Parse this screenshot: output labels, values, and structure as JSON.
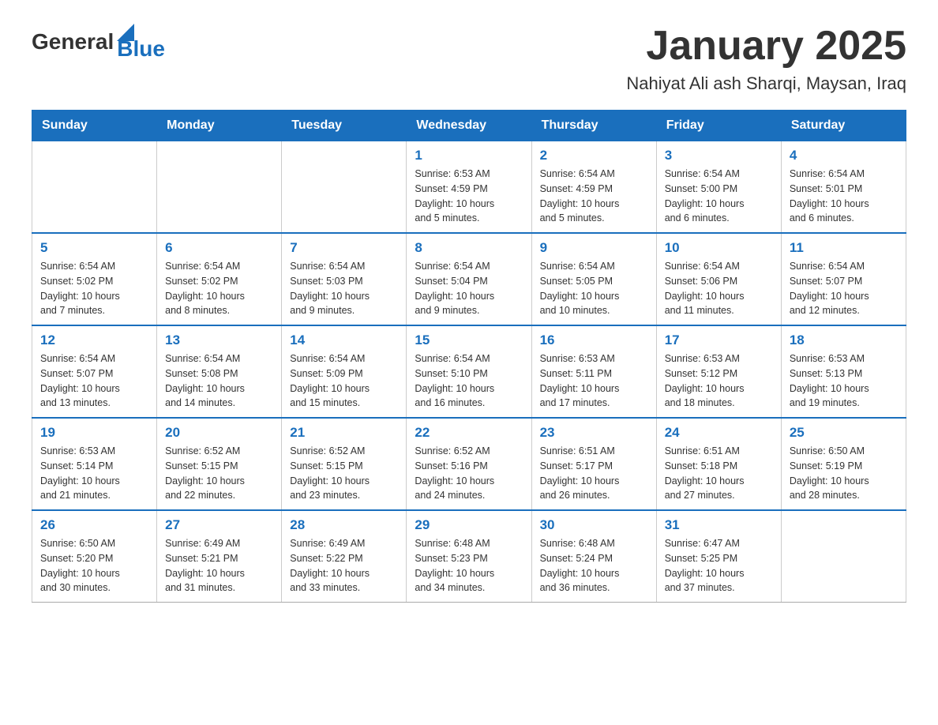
{
  "header": {
    "logo_general": "General",
    "logo_blue": "Blue",
    "month": "January 2025",
    "location": "Nahiyat Ali ash Sharqi, Maysan, Iraq"
  },
  "days_of_week": [
    "Sunday",
    "Monday",
    "Tuesday",
    "Wednesday",
    "Thursday",
    "Friday",
    "Saturday"
  ],
  "weeks": [
    [
      {
        "day": "",
        "info": ""
      },
      {
        "day": "",
        "info": ""
      },
      {
        "day": "",
        "info": ""
      },
      {
        "day": "1",
        "info": "Sunrise: 6:53 AM\nSunset: 4:59 PM\nDaylight: 10 hours\nand 5 minutes."
      },
      {
        "day": "2",
        "info": "Sunrise: 6:54 AM\nSunset: 4:59 PM\nDaylight: 10 hours\nand 5 minutes."
      },
      {
        "day": "3",
        "info": "Sunrise: 6:54 AM\nSunset: 5:00 PM\nDaylight: 10 hours\nand 6 minutes."
      },
      {
        "day": "4",
        "info": "Sunrise: 6:54 AM\nSunset: 5:01 PM\nDaylight: 10 hours\nand 6 minutes."
      }
    ],
    [
      {
        "day": "5",
        "info": "Sunrise: 6:54 AM\nSunset: 5:02 PM\nDaylight: 10 hours\nand 7 minutes."
      },
      {
        "day": "6",
        "info": "Sunrise: 6:54 AM\nSunset: 5:02 PM\nDaylight: 10 hours\nand 8 minutes."
      },
      {
        "day": "7",
        "info": "Sunrise: 6:54 AM\nSunset: 5:03 PM\nDaylight: 10 hours\nand 9 minutes."
      },
      {
        "day": "8",
        "info": "Sunrise: 6:54 AM\nSunset: 5:04 PM\nDaylight: 10 hours\nand 9 minutes."
      },
      {
        "day": "9",
        "info": "Sunrise: 6:54 AM\nSunset: 5:05 PM\nDaylight: 10 hours\nand 10 minutes."
      },
      {
        "day": "10",
        "info": "Sunrise: 6:54 AM\nSunset: 5:06 PM\nDaylight: 10 hours\nand 11 minutes."
      },
      {
        "day": "11",
        "info": "Sunrise: 6:54 AM\nSunset: 5:07 PM\nDaylight: 10 hours\nand 12 minutes."
      }
    ],
    [
      {
        "day": "12",
        "info": "Sunrise: 6:54 AM\nSunset: 5:07 PM\nDaylight: 10 hours\nand 13 minutes."
      },
      {
        "day": "13",
        "info": "Sunrise: 6:54 AM\nSunset: 5:08 PM\nDaylight: 10 hours\nand 14 minutes."
      },
      {
        "day": "14",
        "info": "Sunrise: 6:54 AM\nSunset: 5:09 PM\nDaylight: 10 hours\nand 15 minutes."
      },
      {
        "day": "15",
        "info": "Sunrise: 6:54 AM\nSunset: 5:10 PM\nDaylight: 10 hours\nand 16 minutes."
      },
      {
        "day": "16",
        "info": "Sunrise: 6:53 AM\nSunset: 5:11 PM\nDaylight: 10 hours\nand 17 minutes."
      },
      {
        "day": "17",
        "info": "Sunrise: 6:53 AM\nSunset: 5:12 PM\nDaylight: 10 hours\nand 18 minutes."
      },
      {
        "day": "18",
        "info": "Sunrise: 6:53 AM\nSunset: 5:13 PM\nDaylight: 10 hours\nand 19 minutes."
      }
    ],
    [
      {
        "day": "19",
        "info": "Sunrise: 6:53 AM\nSunset: 5:14 PM\nDaylight: 10 hours\nand 21 minutes."
      },
      {
        "day": "20",
        "info": "Sunrise: 6:52 AM\nSunset: 5:15 PM\nDaylight: 10 hours\nand 22 minutes."
      },
      {
        "day": "21",
        "info": "Sunrise: 6:52 AM\nSunset: 5:15 PM\nDaylight: 10 hours\nand 23 minutes."
      },
      {
        "day": "22",
        "info": "Sunrise: 6:52 AM\nSunset: 5:16 PM\nDaylight: 10 hours\nand 24 minutes."
      },
      {
        "day": "23",
        "info": "Sunrise: 6:51 AM\nSunset: 5:17 PM\nDaylight: 10 hours\nand 26 minutes."
      },
      {
        "day": "24",
        "info": "Sunrise: 6:51 AM\nSunset: 5:18 PM\nDaylight: 10 hours\nand 27 minutes."
      },
      {
        "day": "25",
        "info": "Sunrise: 6:50 AM\nSunset: 5:19 PM\nDaylight: 10 hours\nand 28 minutes."
      }
    ],
    [
      {
        "day": "26",
        "info": "Sunrise: 6:50 AM\nSunset: 5:20 PM\nDaylight: 10 hours\nand 30 minutes."
      },
      {
        "day": "27",
        "info": "Sunrise: 6:49 AM\nSunset: 5:21 PM\nDaylight: 10 hours\nand 31 minutes."
      },
      {
        "day": "28",
        "info": "Sunrise: 6:49 AM\nSunset: 5:22 PM\nDaylight: 10 hours\nand 33 minutes."
      },
      {
        "day": "29",
        "info": "Sunrise: 6:48 AM\nSunset: 5:23 PM\nDaylight: 10 hours\nand 34 minutes."
      },
      {
        "day": "30",
        "info": "Sunrise: 6:48 AM\nSunset: 5:24 PM\nDaylight: 10 hours\nand 36 minutes."
      },
      {
        "day": "31",
        "info": "Sunrise: 6:47 AM\nSunset: 5:25 PM\nDaylight: 10 hours\nand 37 minutes."
      },
      {
        "day": "",
        "info": ""
      }
    ]
  ]
}
